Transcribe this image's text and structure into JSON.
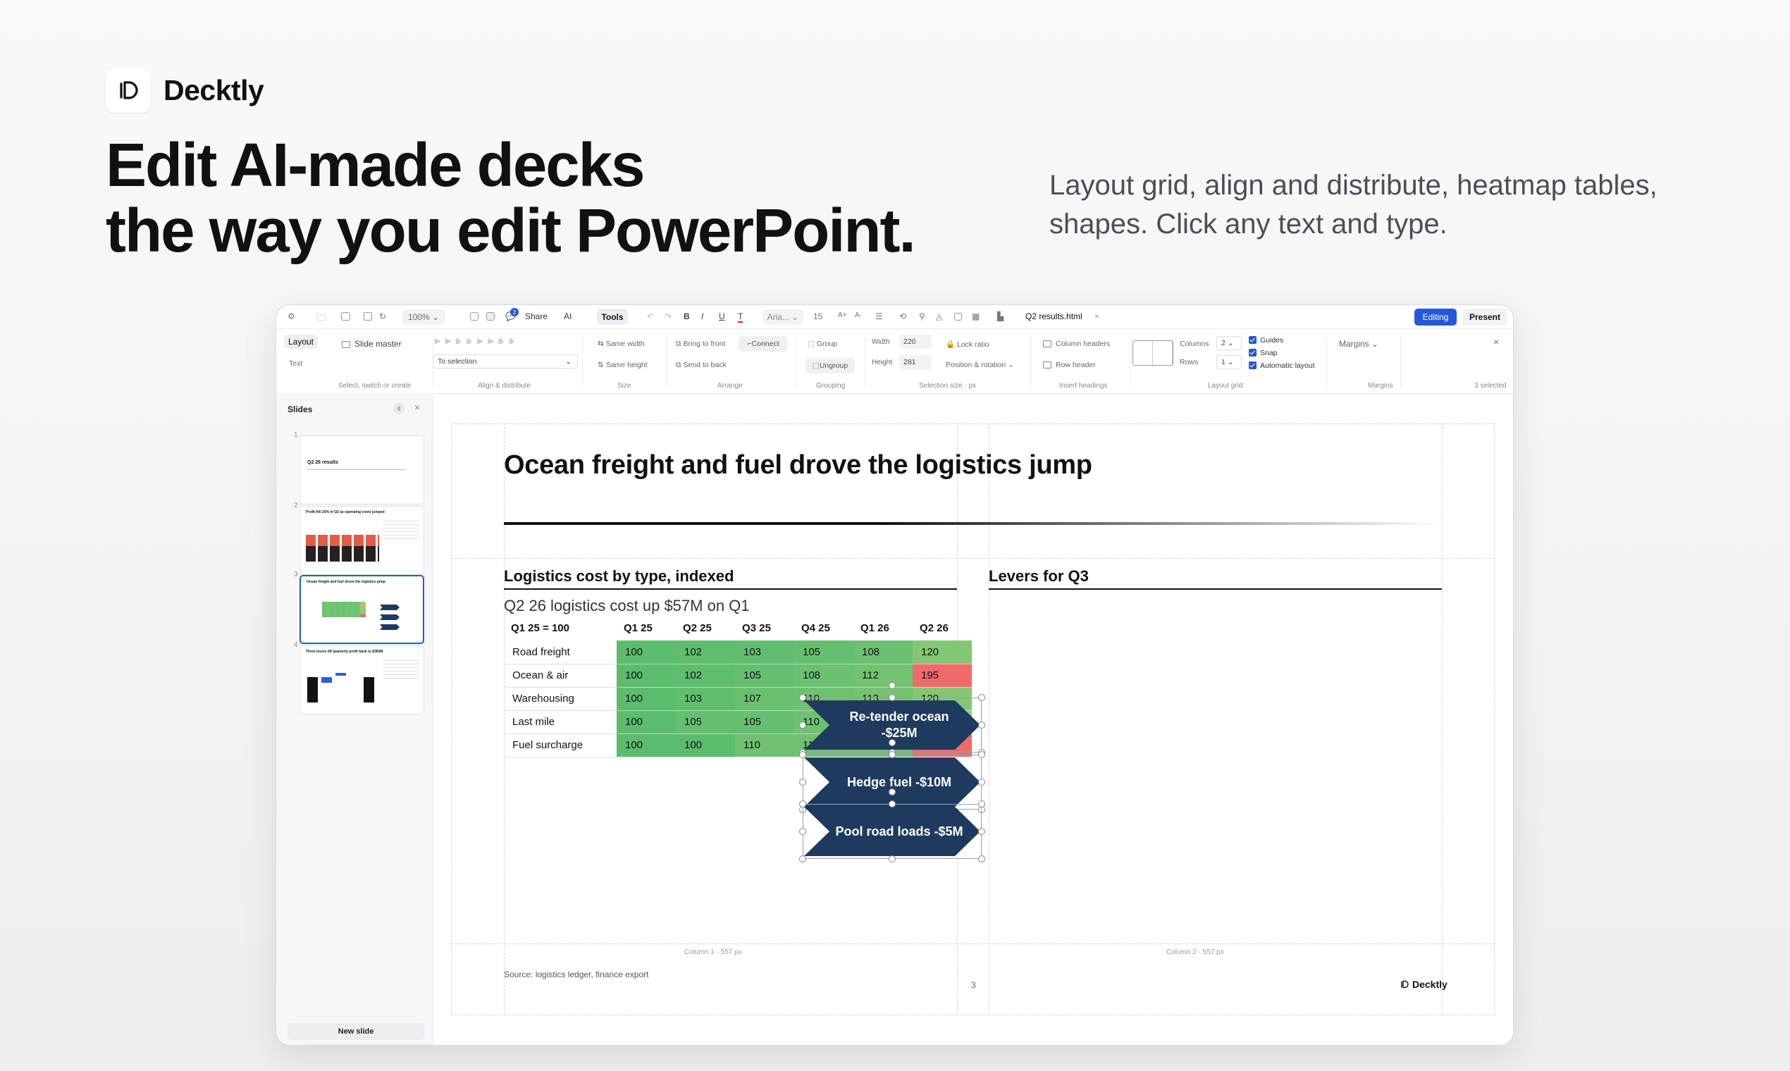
{
  "brand": {
    "name": "Decktly"
  },
  "hero": {
    "headline_line1": "Edit AI-made decks",
    "headline_line2": "the way you edit PowerPoint.",
    "subline": "Layout grid, align and distribute, heatmap tables, shapes. Click any text and type."
  },
  "toolbar": {
    "zoom": "100%",
    "share": "Share",
    "ai": "AI",
    "tools": "Tools",
    "font": "Aria...",
    "font_size": "15",
    "comment_count": "2",
    "filename": "Q2 results.html",
    "editing": "Editing",
    "present": "Present",
    "accent": "#2458d8"
  },
  "ribbon": {
    "tabs": [
      "Layout",
      "Text"
    ],
    "slide_master": "Slide master",
    "to_selection": "To selection",
    "same_width": "Same width",
    "same_height": "Same height",
    "bring_front": "Bring to front",
    "send_back": "Send to back",
    "connect": "Connect",
    "group": "Group",
    "ungroup": "Ungroup",
    "width_label": "Width",
    "width_value": "220",
    "height_label": "Height",
    "height_value": "281",
    "lock_ratio": "Lock ratio",
    "position_rotation": "Position & rotation",
    "column_headers": "Column headers",
    "row_header": "Row header",
    "columns_label": "Columns",
    "columns_value": "2",
    "rows_label": "Rows",
    "rows_value": "1",
    "guides": "Guides",
    "snap": "Snap",
    "auto_layout": "Automatic layout",
    "margins": "Margins",
    "selected": "3 selected",
    "groups": {
      "select": "Select, switch or create",
      "align": "Align & distribute",
      "size": "Size",
      "arrange": "Arrange",
      "grouping": "Grouping",
      "selection_size": "Selection size · px",
      "headings": "Insert headings",
      "layout_grid": "Layout grid",
      "margins": "Margins"
    }
  },
  "sidebar": {
    "title": "Slides",
    "count": "4",
    "new_slide": "New slide",
    "thumbs": [
      {
        "num": "1",
        "title": "Q2 26 results"
      },
      {
        "num": "2",
        "title": "Profit fell 20% in Q2 as operating costs jumped"
      },
      {
        "num": "3",
        "title": "Ocean freight and fuel drove the logistics jump"
      },
      {
        "num": "4",
        "title": "Three levers lift quarterly profit back to $360M"
      }
    ]
  },
  "slide": {
    "title": "Ocean freight and fuel drove the logistics jump",
    "left_heading": "Logistics cost by type, indexed",
    "left_sub": "Q2 26 logistics cost up $57M on Q1",
    "right_heading": "Levers for Q3",
    "source": "Source: logistics ledger, finance export",
    "page_number": "3",
    "footer_brand": "Decktly",
    "col1_note": "Column 1 · 557 px",
    "col2_note": "Column 2 · 557 px",
    "table": {
      "columns": [
        "Q1 25 = 100",
        "Q1 25",
        "Q2 25",
        "Q3 25",
        "Q4 25",
        "Q1 26",
        "Q2 26"
      ],
      "rows": [
        {
          "label": "Road freight",
          "values": [
            "100",
            "102",
            "103",
            "105",
            "108",
            "120"
          ]
        },
        {
          "label": "Ocean & air",
          "values": [
            "100",
            "102",
            "105",
            "108",
            "112",
            "195"
          ]
        },
        {
          "label": "Warehousing",
          "values": [
            "100",
            "103",
            "107",
            "110",
            "113",
            "120"
          ]
        },
        {
          "label": "Last mile",
          "values": [
            "100",
            "105",
            "105",
            "110",
            "115",
            "130"
          ]
        },
        {
          "label": "Fuel surcharge",
          "values": [
            "100",
            "100",
            "110",
            "110",
            "110",
            "230"
          ]
        }
      ]
    },
    "levers": [
      {
        "label": "Re-tender ocean -$25M"
      },
      {
        "label": "Hedge fuel -$10M"
      },
      {
        "label": "Pool road loads -$5M"
      }
    ],
    "lever_color": "#1f3a5f"
  }
}
